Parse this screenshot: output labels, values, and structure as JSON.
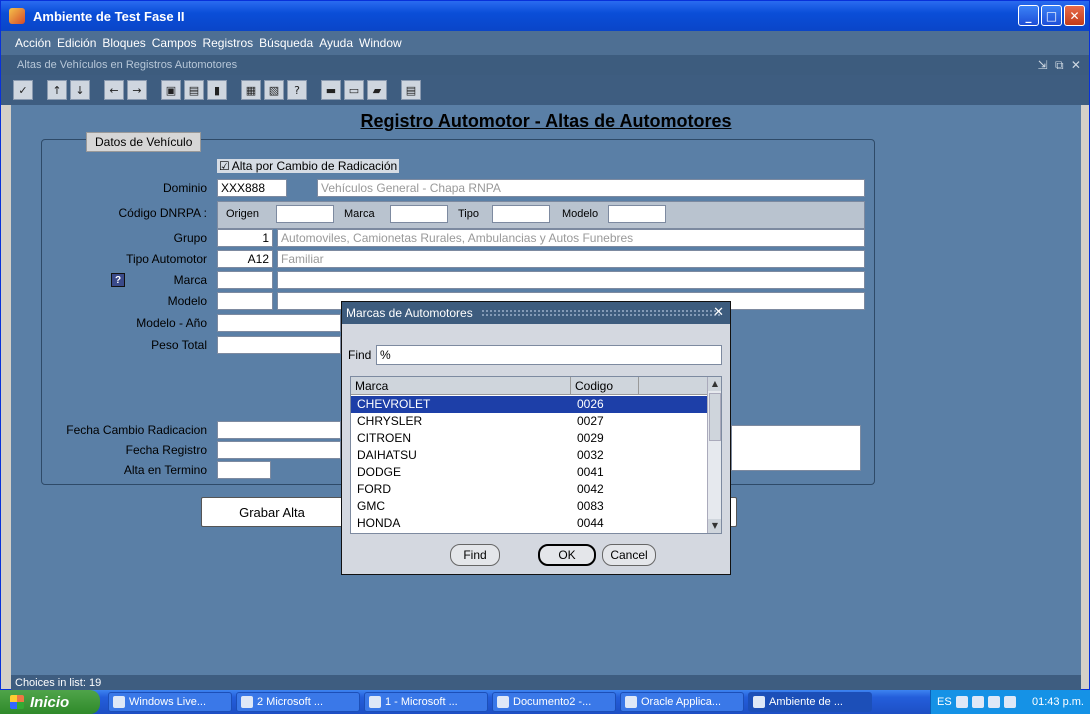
{
  "window": {
    "title": "Ambiente de Test Fase II"
  },
  "menu": [
    "Acción",
    "Edición",
    "Bloques",
    "Campos",
    "Registros",
    "Búsqueda",
    "Ayuda",
    "Window"
  ],
  "form_window": {
    "title": "Altas de Vehículos en Registros Automotores"
  },
  "toolbar_icons": [
    "check-icon",
    "up-arrow-icon",
    "down-arrow-icon",
    "left-arrow-icon",
    "right-arrow-icon",
    "save-icon",
    "clear-icon",
    "exit-icon",
    "copy-icon",
    "paste-icon",
    "help-icon",
    "export-icon",
    "print-icon",
    "window-icon",
    "notes-icon"
  ],
  "heading": "Registro Automotor - Altas de Automotores",
  "frame_label": "Datos de Vehículo",
  "checkbox": {
    "label": "Alta por Cambio de Radicación",
    "checked": true
  },
  "fields": {
    "dominio": {
      "label": "Dominio",
      "value": "XXX888",
      "desc": "Vehículos General - Chapa RNPA"
    },
    "codigo_dnrpa": {
      "label": "Código DNRPA :",
      "origen": "Origen",
      "marca": "Marca",
      "tipo": "Tipo",
      "modelo": "Modelo"
    },
    "grupo": {
      "label": "Grupo",
      "value": "1",
      "desc": "Automoviles, Camionetas Rurales,  Ambulancias y Autos Funebres"
    },
    "tipo_automotor": {
      "label": "Tipo Automotor",
      "value": "A12",
      "desc": "Familiar"
    },
    "marca": {
      "label": "Marca"
    },
    "modelo": {
      "label": "Modelo"
    },
    "modelo_anio": {
      "label": "Modelo - Año"
    },
    "peso_total": {
      "label": "Peso Total"
    },
    "fecha_cambio": {
      "label": "Fecha Cambio Radicacion"
    },
    "fecha_registro": {
      "label": "Fecha Registro"
    },
    "alta_termino": {
      "label": "Alta en Termino"
    }
  },
  "buttons": {
    "grabar": "Grabar Alta"
  },
  "status": "Choices in list: 19",
  "dialog": {
    "title": "Marcas de Automotores",
    "find_label": "Find",
    "find_value": "%",
    "columns": [
      "Marca",
      "Codigo"
    ],
    "rows": [
      {
        "marca": "CHEVROLET",
        "codigo": "0026"
      },
      {
        "marca": "CHRYSLER",
        "codigo": "0027"
      },
      {
        "marca": "CITROEN",
        "codigo": "0029"
      },
      {
        "marca": "DAIHATSU",
        "codigo": "0032"
      },
      {
        "marca": "DODGE",
        "codigo": "0041"
      },
      {
        "marca": "FORD",
        "codigo": "0042"
      },
      {
        "marca": "GMC",
        "codigo": "0083"
      },
      {
        "marca": "HONDA",
        "codigo": "0044"
      }
    ],
    "buttons": {
      "find": "Find",
      "ok": "OK",
      "cancel": "Cancel"
    }
  },
  "taskbar": {
    "start": "Inicio",
    "tasks": [
      "Windows Live...",
      "2 Microsoft ...",
      "1 - Microsoft ...",
      "Documento2 -...",
      "Oracle Applica...",
      "Ambiente de ..."
    ],
    "lang": "ES",
    "clock": "01:43 p.m."
  }
}
